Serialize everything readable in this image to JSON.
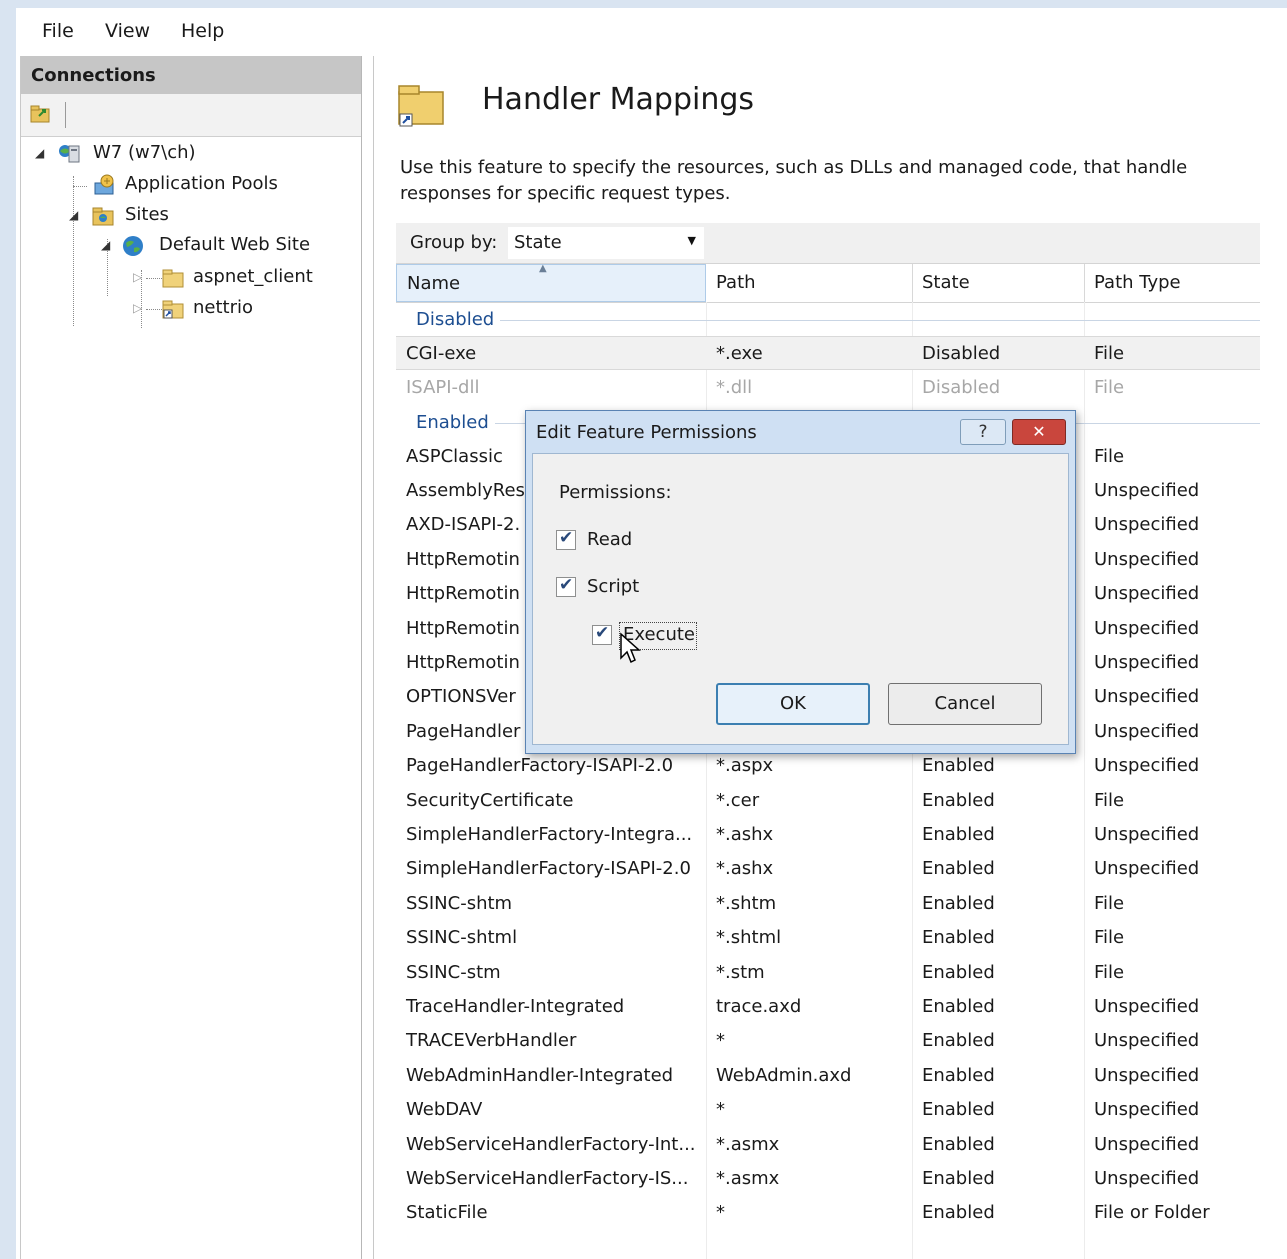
{
  "menu": [
    "File",
    "View",
    "Help"
  ],
  "connections": {
    "title": "Connections",
    "tree": {
      "server": "W7 (w7\\ch)",
      "app_pools": "Application Pools",
      "sites": "Sites",
      "default_site": "Default Web Site",
      "aspnet_client": "aspnet_client",
      "nettrio": "nettrio"
    }
  },
  "main": {
    "title": "Handler Mappings",
    "description": "Use this feature to specify the resources, such as DLLs and managed code, that handle responses for specific request types.",
    "group_by_label": "Group by:",
    "group_by_value": "State",
    "columns": [
      "Name",
      "Path",
      "State",
      "Path Type"
    ],
    "groups": {
      "disabled": "Disabled",
      "enabled": "Enabled"
    },
    "disabled_rows": [
      [
        "CGI-exe",
        "*.exe",
        "Disabled",
        "File"
      ],
      [
        "ISAPI-dll",
        "*.dll",
        "Disabled",
        "File"
      ]
    ],
    "enabled_rows": [
      [
        "ASPClassic",
        "",
        "",
        "File"
      ],
      [
        "AssemblyRes",
        "",
        "",
        "Unspecified"
      ],
      [
        "AXD-ISAPI-2.",
        "",
        "",
        "Unspecified"
      ],
      [
        "HttpRemotin",
        "",
        "",
        "Unspecified"
      ],
      [
        "HttpRemotin",
        "",
        "",
        "Unspecified"
      ],
      [
        "HttpRemotin",
        "",
        "",
        "Unspecified"
      ],
      [
        "HttpRemotin",
        "",
        "",
        "Unspecified"
      ],
      [
        "OPTIONSVer",
        "",
        "",
        "Unspecified"
      ],
      [
        "PageHandler",
        "",
        "",
        "Unspecified"
      ],
      [
        "PageHandlerFactory-ISAPI-2.0",
        "*.aspx",
        "Enabled",
        "Unspecified"
      ],
      [
        "SecurityCertificate",
        "*.cer",
        "Enabled",
        "File"
      ],
      [
        "SimpleHandlerFactory-Integra...",
        "*.ashx",
        "Enabled",
        "Unspecified"
      ],
      [
        "SimpleHandlerFactory-ISAPI-2.0",
        "*.ashx",
        "Enabled",
        "Unspecified"
      ],
      [
        "SSINC-shtm",
        "*.shtm",
        "Enabled",
        "File"
      ],
      [
        "SSINC-shtml",
        "*.shtml",
        "Enabled",
        "File"
      ],
      [
        "SSINC-stm",
        "*.stm",
        "Enabled",
        "File"
      ],
      [
        "TraceHandler-Integrated",
        "trace.axd",
        "Enabled",
        "Unspecified"
      ],
      [
        "TRACEVerbHandler",
        "*",
        "Enabled",
        "Unspecified"
      ],
      [
        "WebAdminHandler-Integrated",
        "WebAdmin.axd",
        "Enabled",
        "Unspecified"
      ],
      [
        "WebDAV",
        "*",
        "Enabled",
        "Unspecified"
      ],
      [
        "WebServiceHandlerFactory-Int...",
        "*.asmx",
        "Enabled",
        "Unspecified"
      ],
      [
        "WebServiceHandlerFactory-IS...",
        "*.asmx",
        "Enabled",
        "Unspecified"
      ],
      [
        "StaticFile",
        "*",
        "Enabled",
        "File or Folder"
      ]
    ]
  },
  "dialog": {
    "title": "Edit Feature Permissions",
    "help": "?",
    "close": "✕",
    "permissions_label": "Permissions:",
    "read": "Read",
    "script": "Script",
    "execute": "Execute",
    "read_checked": true,
    "script_checked": true,
    "execute_checked": true,
    "ok": "OK",
    "cancel": "Cancel"
  },
  "colors": {
    "group_header": "#1d4e91",
    "dialog_frame": "#cfe0f3",
    "close_button": "#c9463d"
  }
}
